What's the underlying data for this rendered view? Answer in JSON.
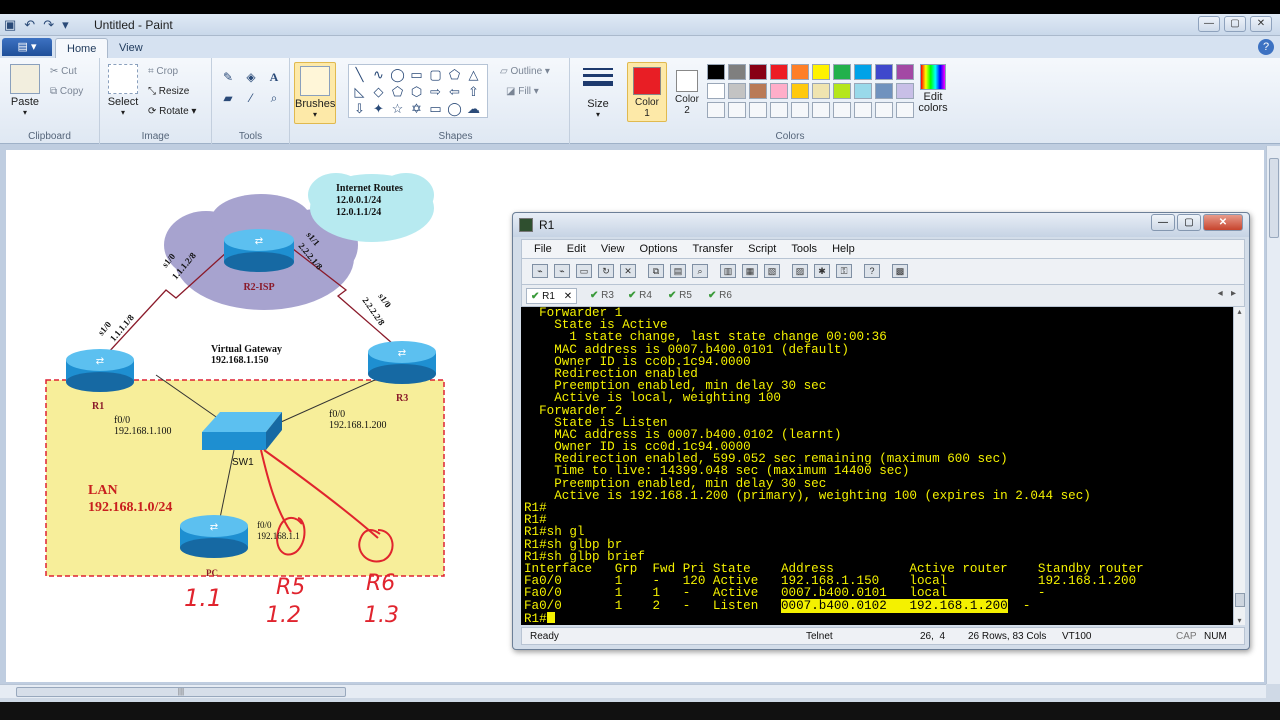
{
  "paint": {
    "title": "Untitled - Paint",
    "tabs": [
      "Home",
      "View"
    ],
    "clipboard": {
      "paste": "Paste",
      "cut": "Cut",
      "copy": "Copy",
      "label": "Clipboard"
    },
    "image": {
      "select": "Select",
      "crop": "Crop",
      "resize": "Resize",
      "rotate": "Rotate",
      "label": "Image"
    },
    "tools_label": "Tools",
    "brushes": "Brushes",
    "shapes": {
      "outline": "Outline",
      "fill": "Fill",
      "label": "Shapes"
    },
    "size": "Size",
    "color1": "Color\n1",
    "color2": "Color\n2",
    "edit_colors": "Edit colors",
    "colors_label": "Colors",
    "color1_value": "#e81e25",
    "color2_value": "#ffffff",
    "palette": [
      "#000000",
      "#7f7f7f",
      "#880015",
      "#ed1c24",
      "#ff7f27",
      "#fff200",
      "#22b14c",
      "#00a2e8",
      "#3f48cc",
      "#a349a4",
      "#ffffff",
      "#c3c3c3",
      "#b97a57",
      "#ffaec9",
      "#ffc90e",
      "#efe4b0",
      "#b5e61d",
      "#99d9ea",
      "#7092be",
      "#c8bfe7"
    ]
  },
  "diagram": {
    "cloud_label": "Internet Routes",
    "routes": [
      "12.0.0.1/24",
      "12.0.1.1/24"
    ],
    "isp": "R2-ISP",
    "link_r1_isp_top": "s1/0",
    "link_r1_isp_top_ip": "1.1.1.2/8",
    "link_isp_r3_top": "s1/1",
    "link_isp_r3_top_ip": "2.2.2.1/8",
    "r1_s": "s1/0",
    "r1_s_ip": "1.1.1.1/8",
    "r3_s": "s1/0",
    "r3_s_ip": "2.2.2.2/8",
    "vgw_title": "Virtual Gateway",
    "vgw_ip": "192.168.1.150",
    "r1": "R1",
    "r3": "R3",
    "r1_f": "f0/0",
    "r1_ip": "192.168.1.100",
    "r3_f": "f0/0",
    "r3_ip": "192.168.1.200",
    "sw": "SW1",
    "lan_title": "LAN",
    "lan_net": "192.168.1.0/24",
    "pc": "PC",
    "pc_f": "f0/0",
    "pc_ip": "192.168.1.1",
    "hand_pc": "1.1",
    "hand_r5": "R5",
    "hand_r5_ip": "1.2",
    "hand_r6": "R6",
    "hand_r6_ip": "1.3"
  },
  "terminal": {
    "title": "R1",
    "menu": [
      "File",
      "Edit",
      "View",
      "Options",
      "Transfer",
      "Script",
      "Tools",
      "Help"
    ],
    "tabs": [
      "R1",
      "R3",
      "R4",
      "R5",
      "R6"
    ],
    "lines": [
      "  Forwarder 1",
      "    State is Active",
      "      1 state change, last state change 00:00:36",
      "    MAC address is 0007.b400.0101 (default)",
      "    Owner ID is cc0b.1c94.0000",
      "    Redirection enabled",
      "    Preemption enabled, min delay 30 sec",
      "    Active is local, weighting 100",
      "  Forwarder 2",
      "    State is Listen",
      "    MAC address is 0007.b400.0102 (learnt)",
      "    Owner ID is cc0d.1c94.0000",
      "    Redirection enabled, 599.052 sec remaining (maximum 600 sec)",
      "    Time to live: 14399.048 sec (maximum 14400 sec)",
      "    Preemption enabled, min delay 30 sec",
      "    Active is 192.168.1.200 (primary), weighting 100 (expires in 2.044 sec)",
      "R1#",
      "R1#",
      "R1#sh gl",
      "R1#sh glbp br",
      "R1#sh glbp brief",
      "Interface   Grp  Fwd Pri State    Address          Active router    Standby router",
      "Fa0/0       1    -   120 Active   192.168.1.150    local            192.168.1.200",
      "Fa0/0       1    1   -   Active   0007.b400.0101   local            -"
    ],
    "hl_prefix": "Fa0/0       1    2   -   Listen   ",
    "hl_text": "0007.b400.0102   192.168.1.200",
    "hl_suffix": "  -",
    "prompt": "R1#",
    "status": {
      "ready": "Ready",
      "proto": "Telnet",
      "pos": "26,  4",
      "size": "26 Rows, 83 Cols",
      "term": "VT100",
      "caps": "CAP",
      "num": "NUM"
    }
  }
}
